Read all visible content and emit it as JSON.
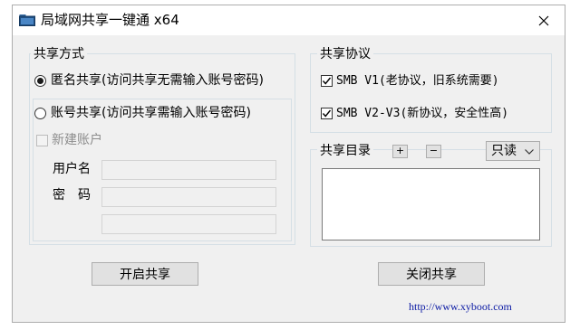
{
  "window": {
    "title": "局域网共享一键通 x64",
    "close_icon": "close-icon",
    "app_icon": "folder-icon"
  },
  "share_mode": {
    "group_title": "共享方式",
    "anonymous_label": "匿名共享(访问共享无需输入账号密码)",
    "anonymous_selected": true,
    "account_label": "账号共享(访问共享需输入账号密码)",
    "account_selected": false,
    "new_account_label": "新建账户",
    "new_account_checked": false,
    "username_label": "用户名",
    "password_label": "密　码",
    "username_value": "",
    "password_value": "",
    "confirm_value": ""
  },
  "protocol": {
    "group_title": "共享协议",
    "smb1_label": "SMB V1(老协议，旧系统需要)",
    "smb1_checked": true,
    "smb2_label": "SMB V2-V3(新协议，安全性高)",
    "smb2_checked": true
  },
  "directory": {
    "group_title": "共享目录",
    "add_label": "+",
    "remove_label": "−",
    "mode_value": "只读",
    "items": []
  },
  "buttons": {
    "start_label": "开启共享",
    "stop_label": "关闭共享"
  },
  "footer": {
    "url": "http://www.xyboot.com"
  }
}
